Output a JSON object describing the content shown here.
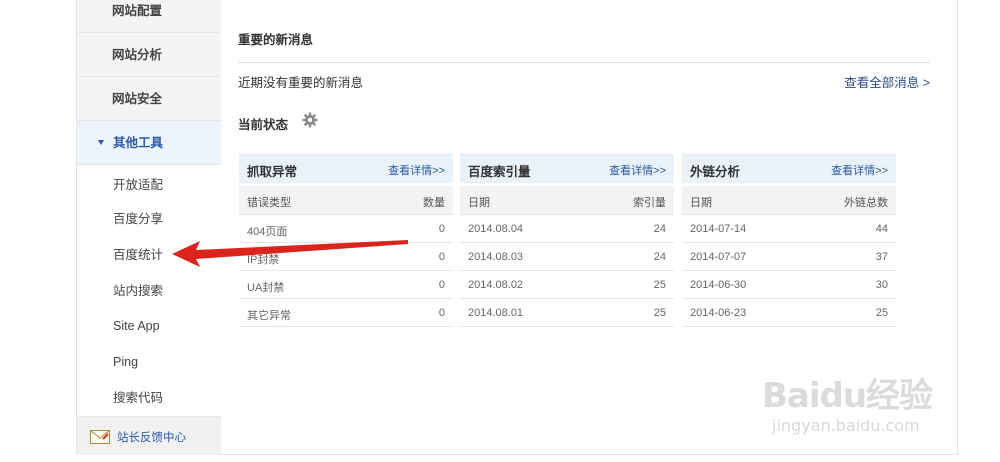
{
  "sidebar": {
    "main_items": [
      {
        "label": "网站配置"
      },
      {
        "label": "网站分析"
      },
      {
        "label": "网站安全"
      },
      {
        "label": "其他工具",
        "active": true
      }
    ],
    "sub_items": [
      {
        "label": "开放适配"
      },
      {
        "label": "百度分享"
      },
      {
        "label": "百度统计"
      },
      {
        "label": "站内搜索"
      },
      {
        "label": "Site App"
      },
      {
        "label": "Ping"
      },
      {
        "label": "搜索代码"
      }
    ],
    "feedback": {
      "label": "站长反馈中心",
      "icon": "mail-icon"
    }
  },
  "messages": {
    "title": "重要的新消息",
    "empty_text": "近期没有重要的新消息",
    "view_all": "查看全部消息 >"
  },
  "status": {
    "title": "当前状态",
    "icon": "gear-icon"
  },
  "panels": [
    {
      "title": "抓取异常",
      "link": "查看详情>>",
      "columns": [
        "错误类型",
        "数量"
      ],
      "rows": [
        [
          "404页面",
          "0"
        ],
        [
          "IP封禁",
          "0"
        ],
        [
          "UA封禁",
          "0"
        ],
        [
          "其它异常",
          "0"
        ]
      ]
    },
    {
      "title": "百度索引量",
      "link": "查看详情>>",
      "columns": [
        "日期",
        "索引量"
      ],
      "rows": [
        [
          "2014.08.04",
          "24"
        ],
        [
          "2014.08.03",
          "24"
        ],
        [
          "2014.08.02",
          "25"
        ],
        [
          "2014.08.01",
          "25"
        ]
      ]
    },
    {
      "title": "外链分析",
      "link": "查看详情>>",
      "columns": [
        "日期",
        "外链总数"
      ],
      "rows": [
        [
          "2014-07-14",
          "44"
        ],
        [
          "2014-07-07",
          "37"
        ],
        [
          "2014-06-30",
          "30"
        ],
        [
          "2014-06-23",
          "25"
        ]
      ]
    }
  ],
  "watermark": {
    "brand": "Baidu经验",
    "url": "jingyan.baidu.com"
  },
  "colors": {
    "accent": "#2a5aa8",
    "panel_header": "#e9f1f9",
    "arrow": "#d9251c"
  }
}
